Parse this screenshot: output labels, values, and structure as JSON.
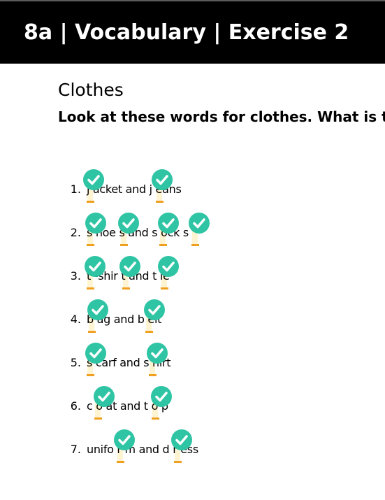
{
  "header": {
    "title": "8a | Vocabulary | Exercise 2"
  },
  "section": {
    "title": "Clothes",
    "instructions": "Look at these words for clothes. What is t"
  },
  "colors": {
    "header_bg": "#000000",
    "check": "#2ec4a4",
    "slot_fill": "#fff4d2",
    "slot_line": "#f0a020"
  },
  "items": [
    {
      "num": "1.",
      "text": "j acket and j eans"
    },
    {
      "num": "2.",
      "text": "s hoe s  and  s ock s"
    },
    {
      "num": "3.",
      "text": "t -shir t  and  t ie"
    },
    {
      "num": "4.",
      "text": "b ag and  b elt"
    },
    {
      "num": "5.",
      "text": "s carf and  s hirt"
    },
    {
      "num": "6.",
      "text": "c o at and t o p"
    },
    {
      "num": "7.",
      "text": "unifo r m and d r ess"
    }
  ]
}
